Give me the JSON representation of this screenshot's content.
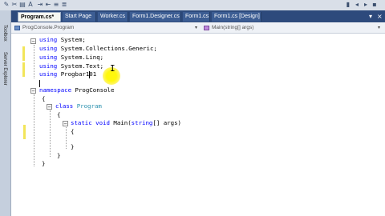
{
  "toolbar": {
    "icons": [
      "edit-icon",
      "cut-icon",
      "paste-icon",
      "find-icon",
      "indent-icon",
      "outdent-icon",
      "comment-icon",
      "uncomment-icon",
      "bookmark-icon",
      "prev-bookmark-icon",
      "next-bookmark-icon",
      "clear-bookmark-icon"
    ]
  },
  "side_panel": {
    "items": [
      "Toolbox",
      "Server Explorer"
    ]
  },
  "tabs": [
    {
      "label": "Program.cs*",
      "active": true
    },
    {
      "label": "Start Page",
      "active": false
    },
    {
      "label": "Worker.cs",
      "active": false
    },
    {
      "label": "Form1.Designer.cs",
      "active": false
    },
    {
      "label": "Form1.cs",
      "active": false
    },
    {
      "label": "Form1.cs [Design]",
      "active": false
    }
  ],
  "tab_buttons": {
    "dropdown": "▾",
    "close": "×"
  },
  "navigation": {
    "type_combo": "ProgConsole.Program",
    "member_combo": "Main(string[] args)"
  },
  "code": {
    "using1_kw": "using",
    "using1_ns": " System;",
    "using2_kw": "using",
    "using2_ns": " System.Collections.Generic;",
    "using3_kw": "using",
    "using3_ns": " System.Linq;",
    "using4_kw": "using",
    "using4_ns": " System.Text;",
    "using5_kw": "using",
    "using5_ns": " Progbar101",
    "ns_kw": "namespace",
    "ns_name": " ProgConsole",
    "brace_open": "{",
    "class_kw": "class",
    "class_name": "Program",
    "method_kw1": "static",
    "method_kw2": "void",
    "method_rest": " Main(",
    "method_kw3": "string",
    "method_rest2": "[] args)",
    "brace_close": "}"
  },
  "colors": {
    "keyword": "#0000ff",
    "type": "#2b91af",
    "tab_strip": "#2d4a7c",
    "highlight": "#fff700"
  }
}
